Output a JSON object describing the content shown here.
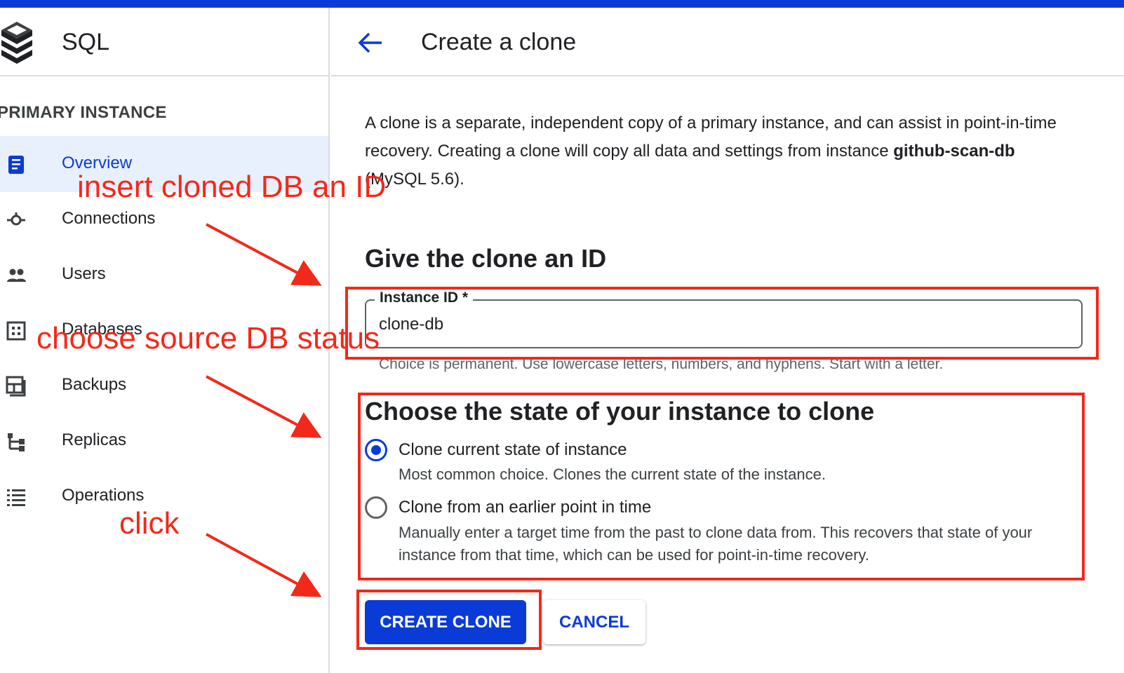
{
  "sidebar": {
    "app_title": "SQL",
    "section_label": "PRIMARY INSTANCE",
    "items": [
      {
        "label": "Overview",
        "icon": "overview-icon",
        "active": true
      },
      {
        "label": "Connections",
        "icon": "connections-icon"
      },
      {
        "label": "Users",
        "icon": "users-icon"
      },
      {
        "label": "Databases",
        "icon": "databases-icon"
      },
      {
        "label": "Backups",
        "icon": "backups-icon"
      },
      {
        "label": "Replicas",
        "icon": "replicas-icon"
      },
      {
        "label": "Operations",
        "icon": "operations-icon"
      }
    ]
  },
  "header": {
    "back_icon": "arrow-back-icon",
    "title": "Create a clone"
  },
  "intro": {
    "text_before": "A clone is a separate, independent copy of a primary instance, and can assist in point-in-time recovery. Creating a clone will copy all data and settings from instance ",
    "instance_name": "github-scan-db",
    "text_after": " (MySQL 5.6)."
  },
  "id_section": {
    "heading": "Give the clone an ID",
    "field_label": "Instance ID *",
    "field_value": "clone-db",
    "hint": "Choice is permanent. Use lowercase letters, numbers, and hyphens. Start with a letter."
  },
  "state_section": {
    "heading": "Choose the state of your instance to clone",
    "options": [
      {
        "title": "Clone current state of instance",
        "description": "Most common choice. Clones the current state of the instance.",
        "selected": true
      },
      {
        "title": "Clone from an earlier point in time",
        "description": "Manually enter a target time from the past to clone data from. This recovers that state of your instance from that time, which can be used for point-in-time recovery.",
        "selected": false
      }
    ]
  },
  "actions": {
    "primary": "CREATE CLONE",
    "secondary": "CANCEL"
  },
  "annotations": {
    "step1": "insert cloned DB an ID",
    "step2": "choose source DB status",
    "step3": "click"
  },
  "colors": {
    "accent": "#0b3bd6",
    "annotation": "#f2291a",
    "active_nav_bg": "#e8f0fe"
  }
}
